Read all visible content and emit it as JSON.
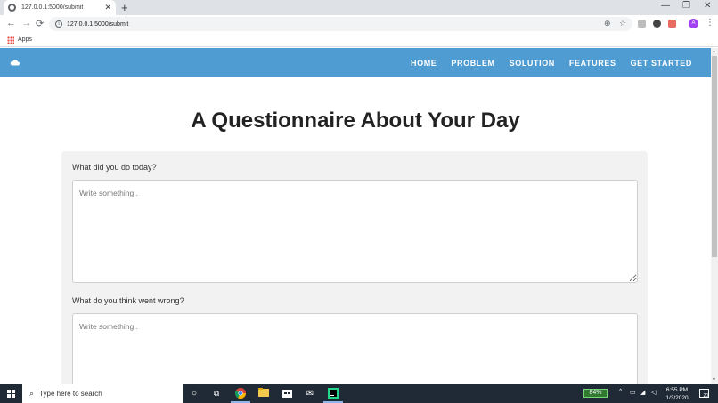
{
  "browser": {
    "tab_title": "127.0.0.1:5000/submit",
    "tab_close": "✕",
    "new_tab": "+",
    "minimize": "—",
    "maximize": "❐",
    "close": "✕",
    "url": "127.0.0.1:5000/submit",
    "back": "←",
    "forward": "→",
    "reload": "⟳",
    "zoom_icon": "⊕",
    "star_icon": "☆",
    "avatar_letter": "A",
    "menu": "⋮",
    "bookmarks": {
      "apps_label": "Apps"
    }
  },
  "site": {
    "nav": [
      "HOME",
      "PROBLEM",
      "SOLUTION",
      "FEATURES",
      "GET STARTED"
    ],
    "title": "A Questionnaire About Your Day",
    "questions": [
      {
        "label": "What did you do today?",
        "placeholder": "Write something.."
      },
      {
        "label": "What do you think went wrong?",
        "placeholder": "Write something.."
      }
    ]
  },
  "taskbar": {
    "search_placeholder": "Type here to search",
    "battery": "84%",
    "time": "6:55 PM",
    "date": "1/3/2020",
    "notification_count": "20"
  },
  "colors": {
    "nav_bg": "#4f9cd2",
    "panel_bg": "#f2f2f2",
    "taskbar_bg": "#1f2a36"
  }
}
